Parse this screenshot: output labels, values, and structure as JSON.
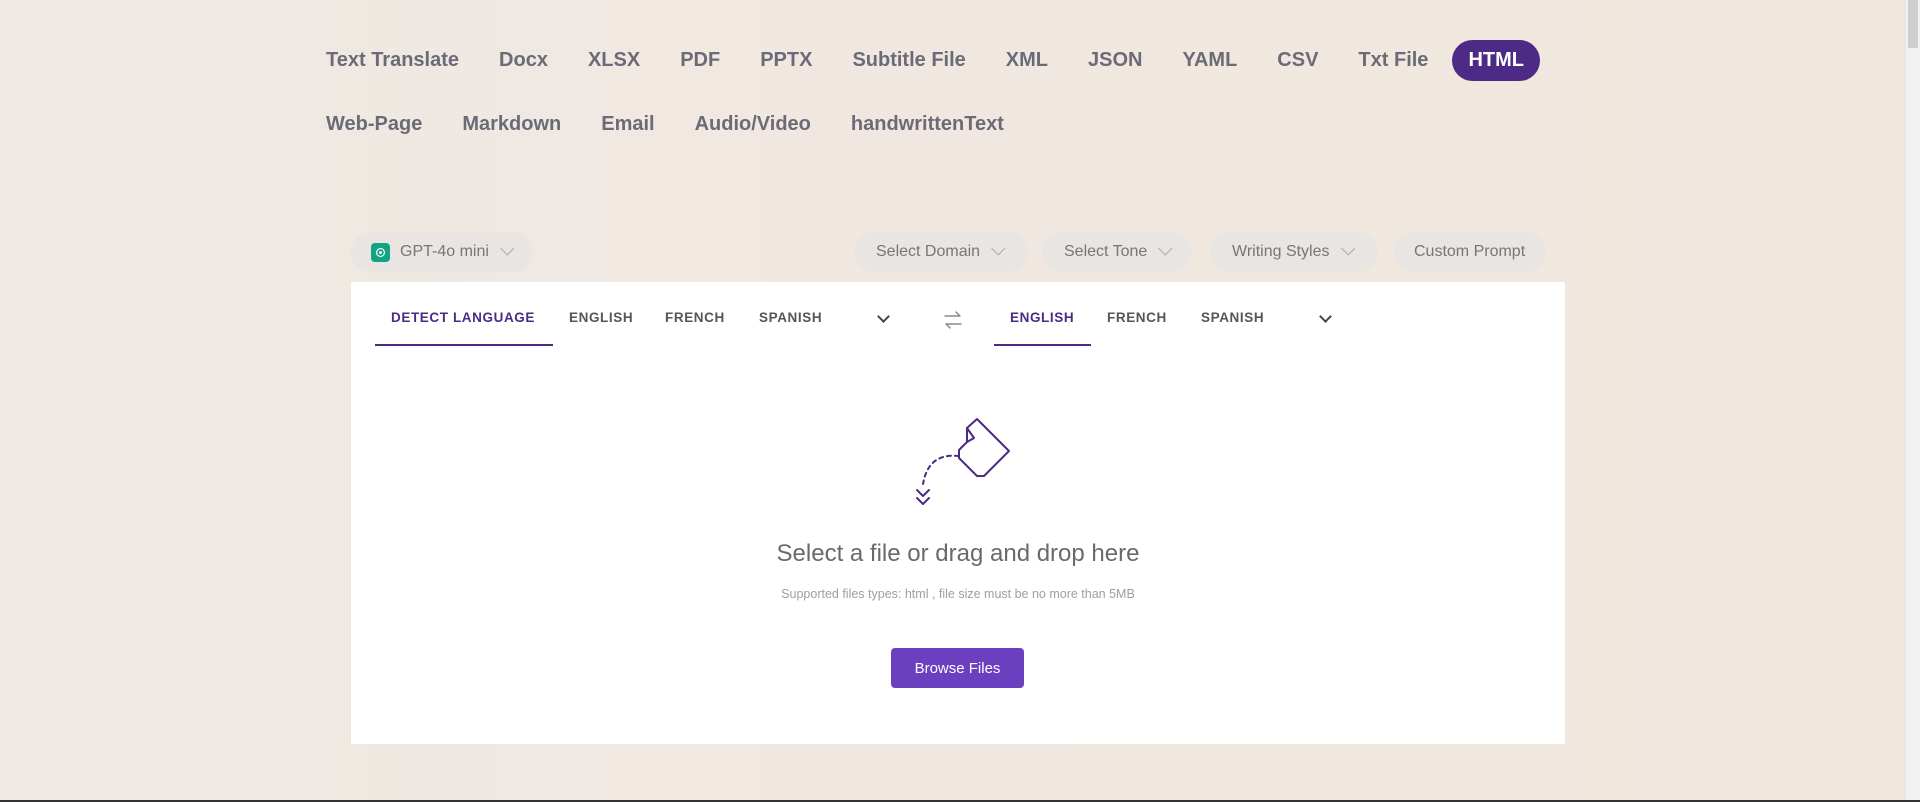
{
  "tabs_row1": [
    "Text Translate",
    "Docx",
    "XLSX",
    "PDF",
    "PPTX",
    "Subtitle File",
    "XML",
    "JSON",
    "YAML",
    "CSV",
    "Txt File",
    "HTML"
  ],
  "tabs_row2": [
    "Web-Page",
    "Markdown",
    "Email",
    "Audio/Video",
    "handwrittenText"
  ],
  "active_tab": "HTML",
  "controls": {
    "model": "GPT-4o mini",
    "domain": "Select Domain",
    "tone": "Select Tone",
    "styles": "Writing Styles",
    "custom": "Custom Prompt"
  },
  "source_langs": [
    "DETECT LANGUAGE",
    "ENGLISH",
    "FRENCH",
    "SPANISH"
  ],
  "target_langs": [
    "ENGLISH",
    "FRENCH",
    "SPANISH"
  ],
  "drop": {
    "title": "Select a file or drag and drop here",
    "subtitle": "Supported files types: html , file size must be no more than 5MB",
    "button": "Browse Files"
  },
  "colors": {
    "accent": "#4c2a86",
    "button": "#6b3fc0",
    "gpt": "#13a383"
  }
}
